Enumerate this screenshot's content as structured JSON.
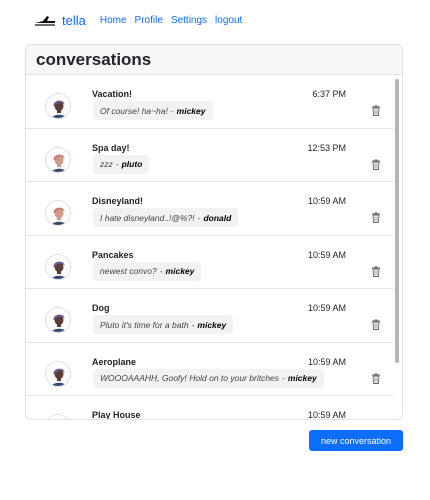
{
  "nav": {
    "brand": "tella",
    "links": [
      "Home",
      "Profile",
      "Settings",
      "logout"
    ]
  },
  "card": {
    "title": "conversations"
  },
  "conversations": [
    {
      "title": "Vacation!",
      "message": "Of course! ha~ha!",
      "author": "mickey",
      "time": "6:37 PM",
      "avatar": "purple-hair-avatar"
    },
    {
      "title": "Spa day!",
      "message": "zzz",
      "author": "pluto",
      "time": "12:53 PM",
      "avatar": "pink-hair-avatar"
    },
    {
      "title": "Disneyland!",
      "message": "I hate disneyland..!@%?!",
      "author": "donald",
      "time": "10:59 AM",
      "avatar": "pink-hair-avatar"
    },
    {
      "title": "Pancakes",
      "message": "newest convo?",
      "author": "mickey",
      "time": "10:59 AM",
      "avatar": "purple-hair-avatar"
    },
    {
      "title": "Dog",
      "message": "Pluto it's time for a bath",
      "author": "mickey",
      "time": "10:59 AM",
      "avatar": "purple-hair-avatar"
    },
    {
      "title": "Aeroplane",
      "message": "WOOOAAAHH, Goofy! Hold on to your britches",
      "author": "mickey",
      "time": "10:59 AM",
      "avatar": "purple-hair-avatar"
    },
    {
      "title": "Play House",
      "message": "",
      "author": "",
      "time": "10:59 AM",
      "avatar": "purple-hair-avatar"
    }
  ],
  "separator": "-",
  "buttons": {
    "new_conversation": "new conversation"
  },
  "colors": {
    "primary": "#0d6efd",
    "hair_purple": "#6b5a8f",
    "hair_pink": "#c77b72"
  }
}
